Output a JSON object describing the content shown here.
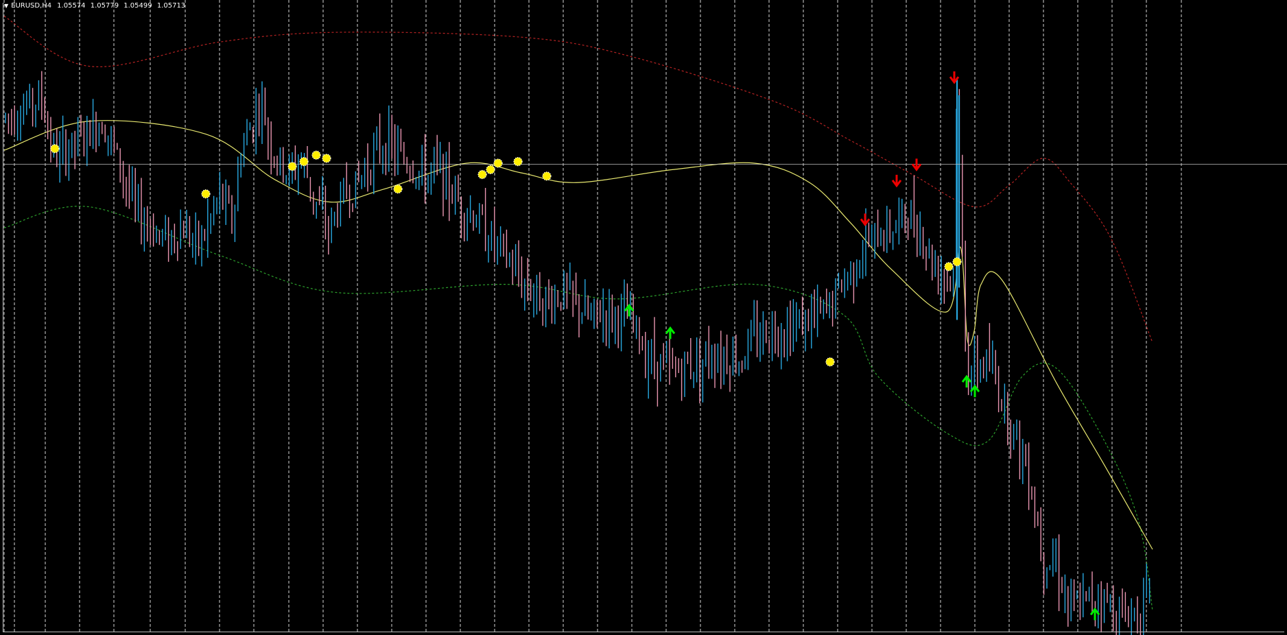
{
  "header": {
    "menu_icon": "triangle-down-icon",
    "symbol": "EURUSD,H4",
    "values": [
      "1.05574",
      "1.05779",
      "1.05499",
      "1.05713"
    ]
  },
  "colors": {
    "background": "#000000",
    "bull_candle": "#29a8e0",
    "bear_candle": "#e895b0",
    "center_line": "#e8e870",
    "upper_band": "#b52222",
    "lower_band": "#2ca02c",
    "grid": "#ffffff",
    "price_line": "#c0c0c0",
    "buy_arrow": "#00ee00",
    "sell_arrow": "#ee0000",
    "signal_dot": "#ffee00"
  },
  "chart_data": {
    "type": "candlestick",
    "grid": "vertical-dashed",
    "series": [
      {
        "key": "price_path",
        "values": [
          1.06,
          1.0612,
          1.0575,
          1.059,
          1.06,
          1.054,
          1.0525,
          1.0532,
          1.052,
          1.053,
          1.0552,
          1.0535,
          1.0578,
          1.061,
          1.0575,
          1.0565,
          1.0575,
          1.0548,
          1.053,
          1.0552,
          1.0558,
          1.0575,
          1.0585,
          1.057,
          1.0563,
          1.057,
          1.0552,
          1.0535,
          1.05,
          1.0485,
          1.0493,
          1.0475,
          1.048,
          1.0475,
          1.0455,
          1.0443,
          1.0448,
          1.0455,
          1.045,
          1.0465,
          1.0478,
          1.052,
          1.0533,
          1.054,
          1.051,
          1.05,
          1.061,
          1.044,
          1.045,
          1.038,
          1.033,
          1.0325,
          1.0295,
          1.0305,
          1.029,
          1.0305
        ]
      },
      {
        "key": "center",
        "values": [
          1.058,
          1.0598,
          1.059,
          1.0562,
          1.0548,
          1.0556,
          1.0572,
          1.0566,
          1.056,
          1.0568,
          1.0572,
          1.056,
          1.0535,
          1.0506,
          1.048,
          1.0463,
          1.0468,
          1.0497,
          1.052,
          1.05,
          1.0436,
          1.0385,
          1.0333
        ]
      },
      {
        "key": "upper",
        "values": [
          1.0663,
          1.0632,
          1.0647,
          1.0653,
          1.065,
          1.0638,
          1.061,
          1.0586,
          1.0565,
          1.0545,
          1.0558,
          1.0575,
          1.056,
          1.0525,
          1.0461
        ]
      },
      {
        "key": "lower",
        "values": [
          1.0532,
          1.0545,
          1.0515,
          1.0492,
          1.0497,
          1.0488,
          1.0497,
          1.0478,
          1.044,
          1.0405,
          1.04,
          1.044,
          1.0445,
          1.04,
          1.035,
          1.0295
        ]
      }
    ],
    "signals": {
      "buy": [
        1.0481,
        1.0467,
        1.0437,
        1.0431,
        1.0293
      ],
      "sell": [
        1.0537,
        1.0561,
        1.0571,
        1.0625
      ],
      "dots": [
        1.0581,
        1.0553,
        1.057,
        1.0573,
        1.0577,
        1.0575,
        1.0556,
        1.0565,
        1.0568,
        1.0572,
        1.0573,
        1.0564,
        1.0449,
        1.0508,
        1.0511
      ]
    },
    "price_line": 1.05713
  }
}
